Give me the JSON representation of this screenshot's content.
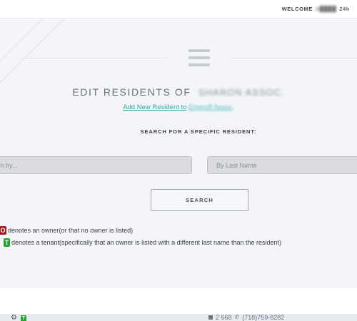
{
  "header": {
    "welcome_label": "WELCOME",
    "welcome_name": "S████",
    "welcome_time": "24h"
  },
  "menu": {
    "icon": "hamburger-menu-icon"
  },
  "page": {
    "title": "EDIT RESIDENTS OF",
    "association_name": "SHARON ASSOC.",
    "add_link_text": "Add New Resident to",
    "add_link_assoc": "Emeroff Assoc",
    "add_link_suffix": ".",
    "search_heading": "SEARCH FOR A SPECIFIC RESIDENT:"
  },
  "search": {
    "left_placeholder": "rch by...",
    "right_placeholder": "By Last Name",
    "button_label": "SEARCH"
  },
  "legend": {
    "owner_badge": "O",
    "owner_text": "denotes an owner(or that no owner is listed)",
    "tenant_badge": "T",
    "tenant_text": "denotes a tenant(specifically that an owner is listed with a different last name than the resident)"
  },
  "footer": {
    "settings_icon": "gear-icon",
    "tenant_mini_badge": "T",
    "right_text_1": "2 668",
    "right_text_2": "(718)759-8282"
  },
  "colors": {
    "accent_link": "#2aa99a",
    "owner_badge": "#b0161a",
    "tenant_badge": "#22a530",
    "panel_bg": "#f3f5f9"
  }
}
